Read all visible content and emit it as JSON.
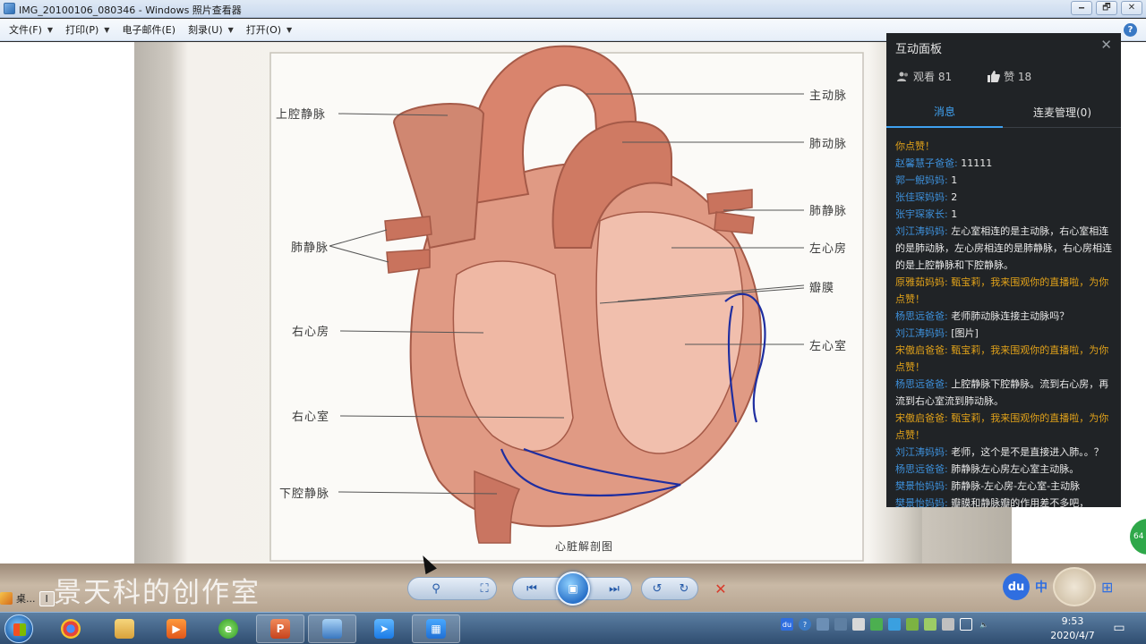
{
  "window": {
    "title": "IMG_20100106_080346 - Windows 照片查看器",
    "minimize": "🗕",
    "restore": "🗗",
    "close": "✕"
  },
  "menu": [
    {
      "label": "文件(F)",
      "has_caret": true
    },
    {
      "label": "打印(P)",
      "has_caret": true
    },
    {
      "label": "电子邮件(E)",
      "has_caret": false
    },
    {
      "label": "刻录(U)",
      "has_caret": true
    },
    {
      "label": "打开(O)",
      "has_caret": true
    }
  ],
  "menu_help": "?",
  "figure": {
    "labels": {
      "svc_top": "上腔静脉",
      "aorta": "主动脉",
      "pulm_artery": "肺动脉",
      "pulm_vein_left": "肺静脉",
      "pulm_vein_right": "肺静脉",
      "left_atrium": "左心房",
      "valve": "瓣膜",
      "right_atrium": "右心房",
      "left_ventricle": "左心室",
      "right_ventricle": "右心室",
      "ivc": "下腔静脉",
      "caption": "心脏解剖图"
    }
  },
  "panel": {
    "title": "互动面板",
    "close": "✕",
    "viewers_label": "观看 81",
    "likes_label": "赞 18",
    "tabs": [
      {
        "label": "消息",
        "active": true
      },
      {
        "label": "连麦管理(0)",
        "active": false
      }
    ],
    "messages": [
      {
        "type": "sys",
        "name": "",
        "body": "你点赞！"
      },
      {
        "type": "chat",
        "name": "赵馨慧子爸爸:",
        "body": " 11111"
      },
      {
        "type": "chat",
        "name": "郭一鲵妈妈:",
        "body": " 1"
      },
      {
        "type": "chat",
        "name": "张佳琛妈妈:",
        "body": " 2"
      },
      {
        "type": "chat",
        "name": "张宇琛家长:",
        "body": " 1"
      },
      {
        "type": "chat",
        "name": "刘江涛妈妈:",
        "body": " 左心室相连的是主动脉，右心室相连的是肺动脉，左心房相连的是肺静脉，右心房相连的是上腔静脉和下腔静脉。"
      },
      {
        "type": "gift",
        "name": "原雅茹妈妈:",
        "body": " 甄宝莉，我来围观你的直播啦，为你点赞！"
      },
      {
        "type": "chat",
        "name": "杨思远爸爸:",
        "body": " 老师肺动脉连接主动脉吗？"
      },
      {
        "type": "chat",
        "name": "刘江涛妈妈:",
        "body": " [图片]"
      },
      {
        "type": "gift",
        "name": "宋傲启爸爸:",
        "body": " 甄宝莉，我来围观你的直播啦，为你点赞！"
      },
      {
        "type": "chat",
        "name": "杨思远爸爸:",
        "body": " 上腔静脉下腔静脉。流到右心房，再流到右心室流到肺动脉。"
      },
      {
        "type": "gift",
        "name": "宋傲启爸爸:",
        "body": " 甄宝莉，我来围观你的直播啦，为你点赞！"
      },
      {
        "type": "chat",
        "name": "刘江涛妈妈:",
        "body": " 老师，这个是不是直接进入肺。。？"
      },
      {
        "type": "chat",
        "name": "杨思远爸爸:",
        "body": " 肺静脉左心房左心室主动脉。"
      },
      {
        "type": "chat",
        "name": "樊景怡妈妈:",
        "body": " 肺静脉-左心房-左心室-主动脉"
      },
      {
        "type": "chat",
        "name": "樊景怡妈妈:",
        "body": " 瓣膜和静脉瓣的作用差不多吧，"
      }
    ]
  },
  "toolbar": {
    "watermark": "景天科的创作室",
    "zoom": "⚲",
    "fit": "⛶",
    "prev": "⏮",
    "slideshow": "▣",
    "next": "⏭",
    "rotate_left": "↺",
    "rotate_right": "↻",
    "delete": "✕",
    "left_task_label": "桌...",
    "left_task_seg": "Ⅰ",
    "ime_du": "du",
    "ime_zh": "中",
    "ime_grid": "⊞",
    "side_badge": "64"
  },
  "taskbar": {
    "apps": [
      "win",
      "chrome",
      "folder",
      "media",
      "360",
      "ppt",
      "photos",
      "feishu",
      "calendar"
    ],
    "time": "9:53",
    "date": "2020/4/7",
    "tray_du": "du",
    "tray_help": "?"
  }
}
